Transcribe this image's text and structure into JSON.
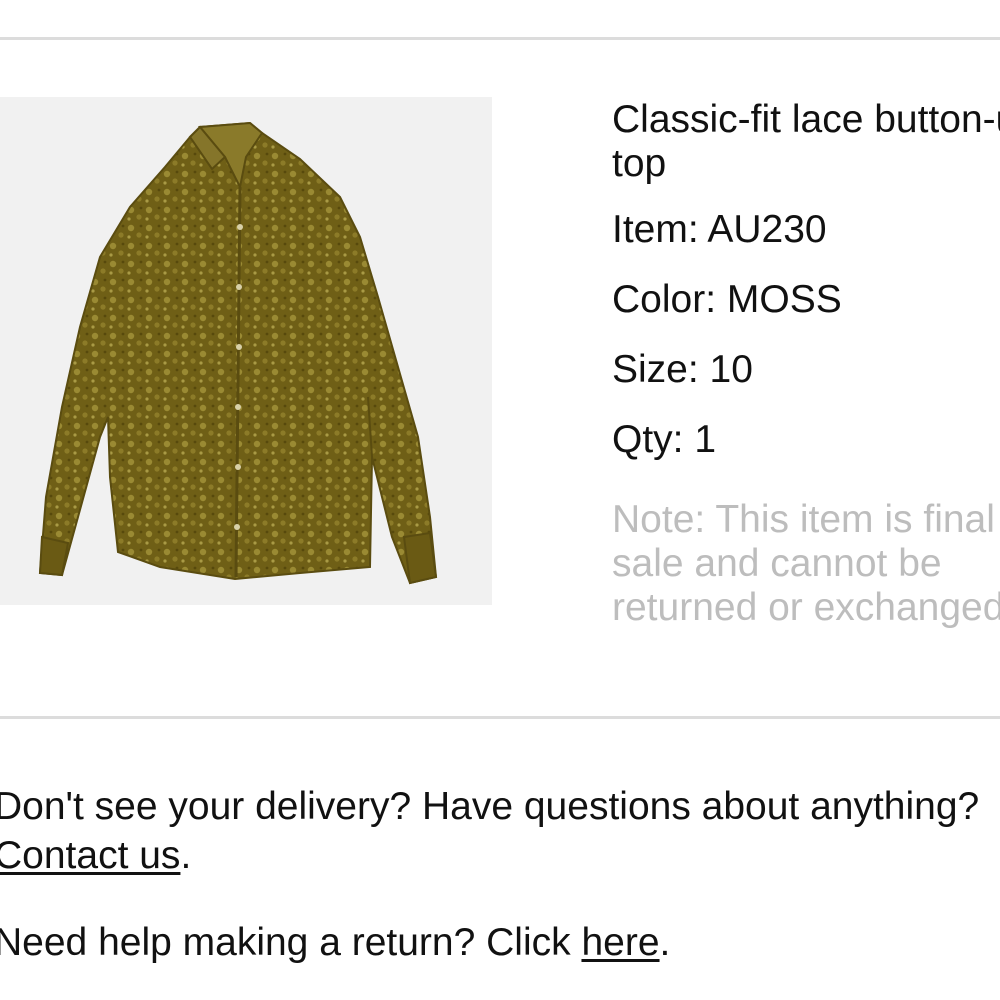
{
  "product": {
    "name": "Classic-fit lace button-up top",
    "item_label": "Item: AU230",
    "color_label": "Color: MOSS",
    "size_label": "Size: 10",
    "qty_label": "Qty: 1",
    "note": "Note: This item is final sale and cannot be returned or exchanged."
  },
  "help": {
    "delivery_text": "Don't see your delivery? Have questions about anything?",
    "contact_link": "Contact us",
    "contact_suffix": ".",
    "return_text": "Need help making a return? Click ",
    "return_link": "here",
    "return_suffix": "."
  },
  "colors": {
    "divider": "#dcdcdc",
    "note_text": "#bdbdbd",
    "shirt": "#7a6a1c"
  }
}
